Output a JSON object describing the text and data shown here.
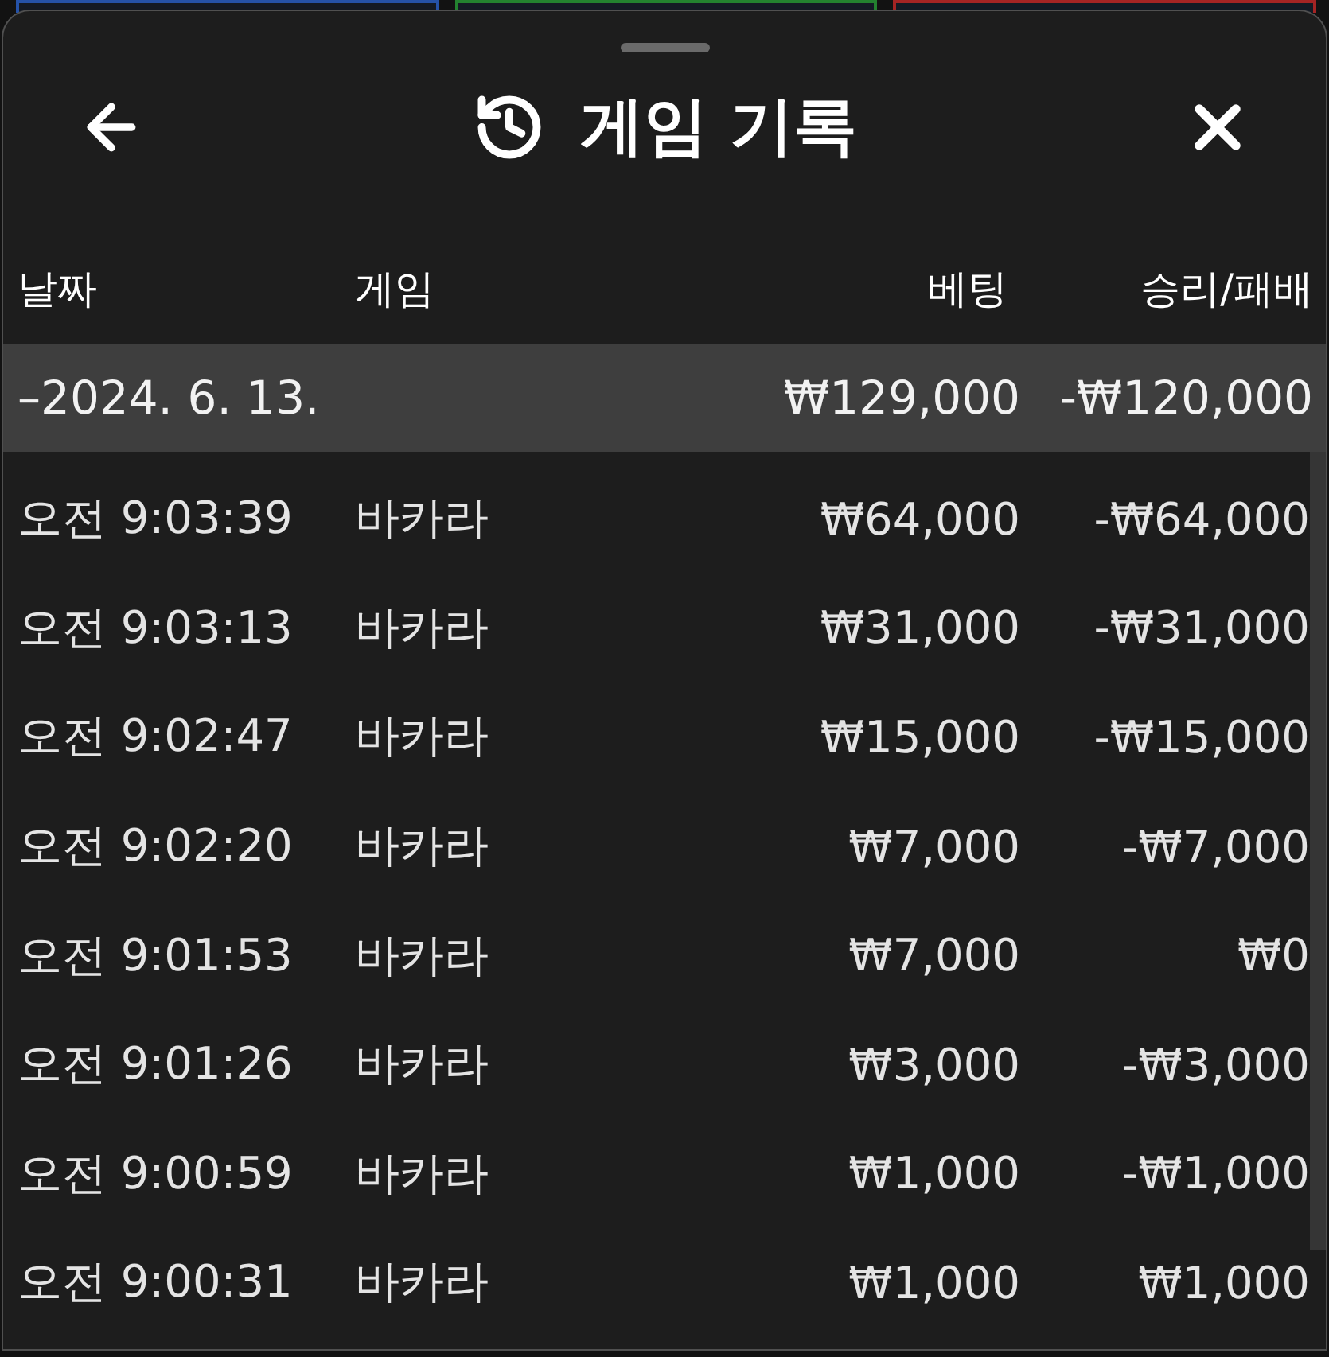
{
  "board_panels": [
    {
      "kind": "player"
    },
    {
      "kind": "tie"
    },
    {
      "kind": "banker"
    }
  ],
  "sheet": {
    "title": "게임 기록"
  },
  "columns": [
    "날짜",
    "게임",
    "베팅",
    "승리/패배"
  ],
  "groups": [
    {
      "label": "–2024. 6. 13.",
      "expanded": true,
      "bet": "₩129,000",
      "result": "-₩120,000",
      "rows": [
        {
          "time": "오전 9:03:39",
          "game": "바카라",
          "bet": "₩64,000",
          "result": "-₩64,000"
        },
        {
          "time": "오전 9:03:13",
          "game": "바카라",
          "bet": "₩31,000",
          "result": "-₩31,000"
        },
        {
          "time": "오전 9:02:47",
          "game": "바카라",
          "bet": "₩15,000",
          "result": "-₩15,000"
        },
        {
          "time": "오전 9:02:20",
          "game": "바카라",
          "bet": "₩7,000",
          "result": "-₩7,000"
        },
        {
          "time": "오전 9:01:53",
          "game": "바카라",
          "bet": "₩7,000",
          "result": "₩0"
        },
        {
          "time": "오전 9:01:26",
          "game": "바카라",
          "bet": "₩3,000",
          "result": "-₩3,000"
        },
        {
          "time": "오전 9:00:59",
          "game": "바카라",
          "bet": "₩1,000",
          "result": "-₩1,000"
        },
        {
          "time": "오전 9:00:31",
          "game": "바카라",
          "bet": "₩1,000",
          "result": "₩1,000"
        }
      ]
    }
  ]
}
